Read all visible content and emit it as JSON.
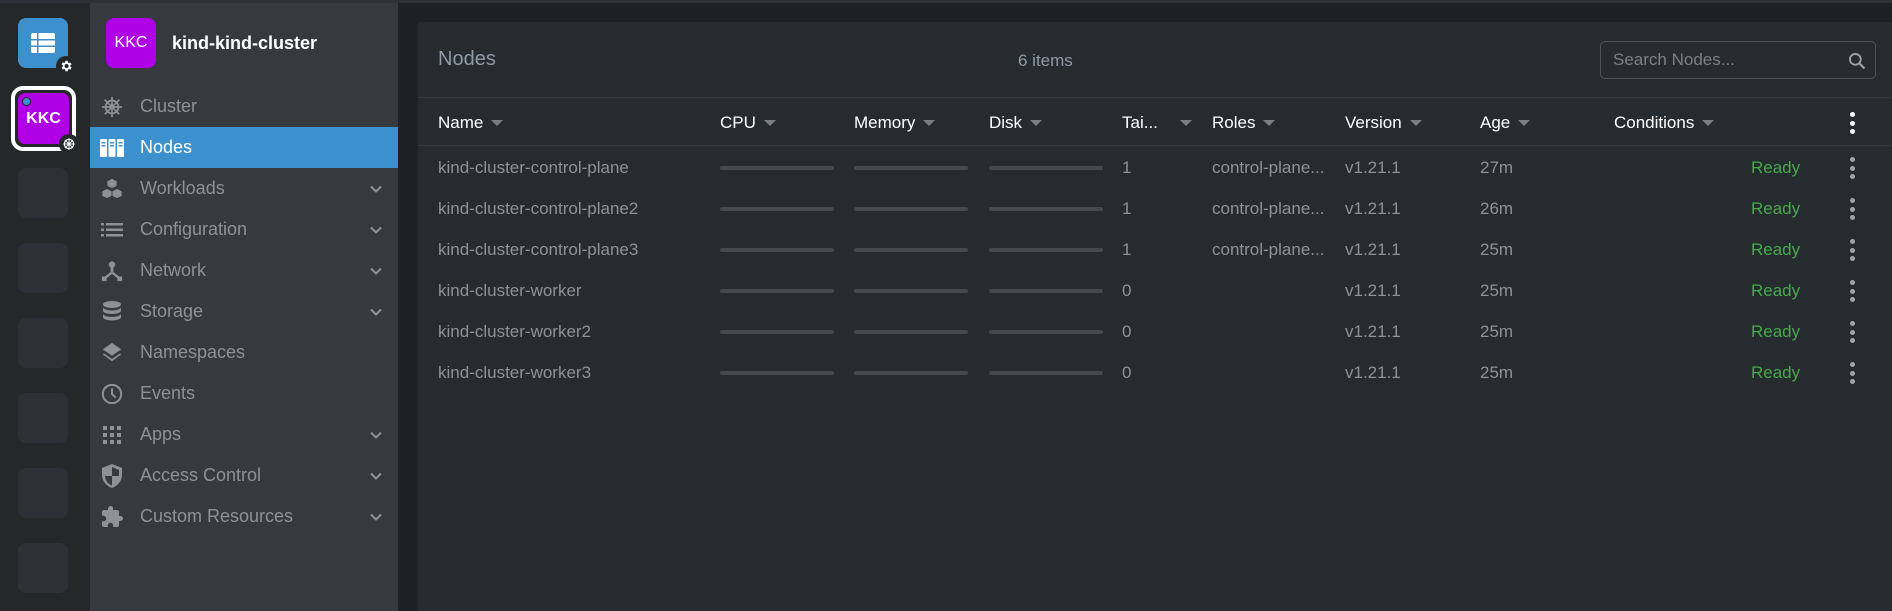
{
  "rail": {
    "catalog_icon": "catalog-icon",
    "catalog_badge_icon": "gear-icon",
    "cluster_tile": {
      "label": "KKC",
      "color": "#b000e6",
      "badge_icon": "kubernetes-icon",
      "status_dot_color": "#3d90ce"
    },
    "empty_slots": 6
  },
  "sidebar": {
    "cluster_avatar": "KKC",
    "cluster_name": "kind-kind-cluster",
    "items": [
      {
        "label": "Cluster",
        "icon": "helm-icon",
        "expandable": false,
        "active": false
      },
      {
        "label": "Nodes",
        "icon": "nodes-icon",
        "expandable": false,
        "active": true
      },
      {
        "label": "Workloads",
        "icon": "cubes-icon",
        "expandable": true,
        "active": false
      },
      {
        "label": "Configuration",
        "icon": "list-icon",
        "expandable": true,
        "active": false
      },
      {
        "label": "Network",
        "icon": "network-icon",
        "expandable": true,
        "active": false
      },
      {
        "label": "Storage",
        "icon": "database-icon",
        "expandable": true,
        "active": false
      },
      {
        "label": "Namespaces",
        "icon": "layers-icon",
        "expandable": false,
        "active": false
      },
      {
        "label": "Events",
        "icon": "clock-icon",
        "expandable": false,
        "active": false
      },
      {
        "label": "Apps",
        "icon": "apps-grid-icon",
        "expandable": true,
        "active": false
      },
      {
        "label": "Access Control",
        "icon": "shield-icon",
        "expandable": true,
        "active": false
      },
      {
        "label": "Custom Resources",
        "icon": "puzzle-icon",
        "expandable": true,
        "active": false
      }
    ]
  },
  "main": {
    "title": "Nodes",
    "item_count": "6 items",
    "search": {
      "placeholder": "Search Nodes...",
      "value": ""
    },
    "columns": [
      "Name",
      "CPU",
      "Memory",
      "Disk",
      "Tai...",
      "Roles",
      "Version",
      "Age",
      "Conditions"
    ],
    "rows": [
      {
        "name": "kind-cluster-control-plane",
        "cpu": 0,
        "memory": 0,
        "disk": 0,
        "taints": "1",
        "roles": "control-plane...",
        "version": "v1.21.1",
        "age": "27m",
        "conditions": "Ready"
      },
      {
        "name": "kind-cluster-control-plane2",
        "cpu": 0,
        "memory": 0,
        "disk": 0,
        "taints": "1",
        "roles": "control-plane...",
        "version": "v1.21.1",
        "age": "26m",
        "conditions": "Ready"
      },
      {
        "name": "kind-cluster-control-plane3",
        "cpu": 0,
        "memory": 0,
        "disk": 0,
        "taints": "1",
        "roles": "control-plane...",
        "version": "v1.21.1",
        "age": "25m",
        "conditions": "Ready"
      },
      {
        "name": "kind-cluster-worker",
        "cpu": 0,
        "memory": 0,
        "disk": 0,
        "taints": "0",
        "roles": "",
        "version": "v1.21.1",
        "age": "25m",
        "conditions": "Ready"
      },
      {
        "name": "kind-cluster-worker2",
        "cpu": 0,
        "memory": 0,
        "disk": 0,
        "taints": "0",
        "roles": "",
        "version": "v1.21.1",
        "age": "25m",
        "conditions": "Ready"
      },
      {
        "name": "kind-cluster-worker3",
        "cpu": 0,
        "memory": 0,
        "disk": 0,
        "taints": "0",
        "roles": "",
        "version": "v1.21.1",
        "age": "25m",
        "conditions": "Ready"
      }
    ]
  },
  "colors": {
    "accent": "#3d90ce",
    "ready": "#48a84c",
    "cluster": "#b000e6"
  }
}
